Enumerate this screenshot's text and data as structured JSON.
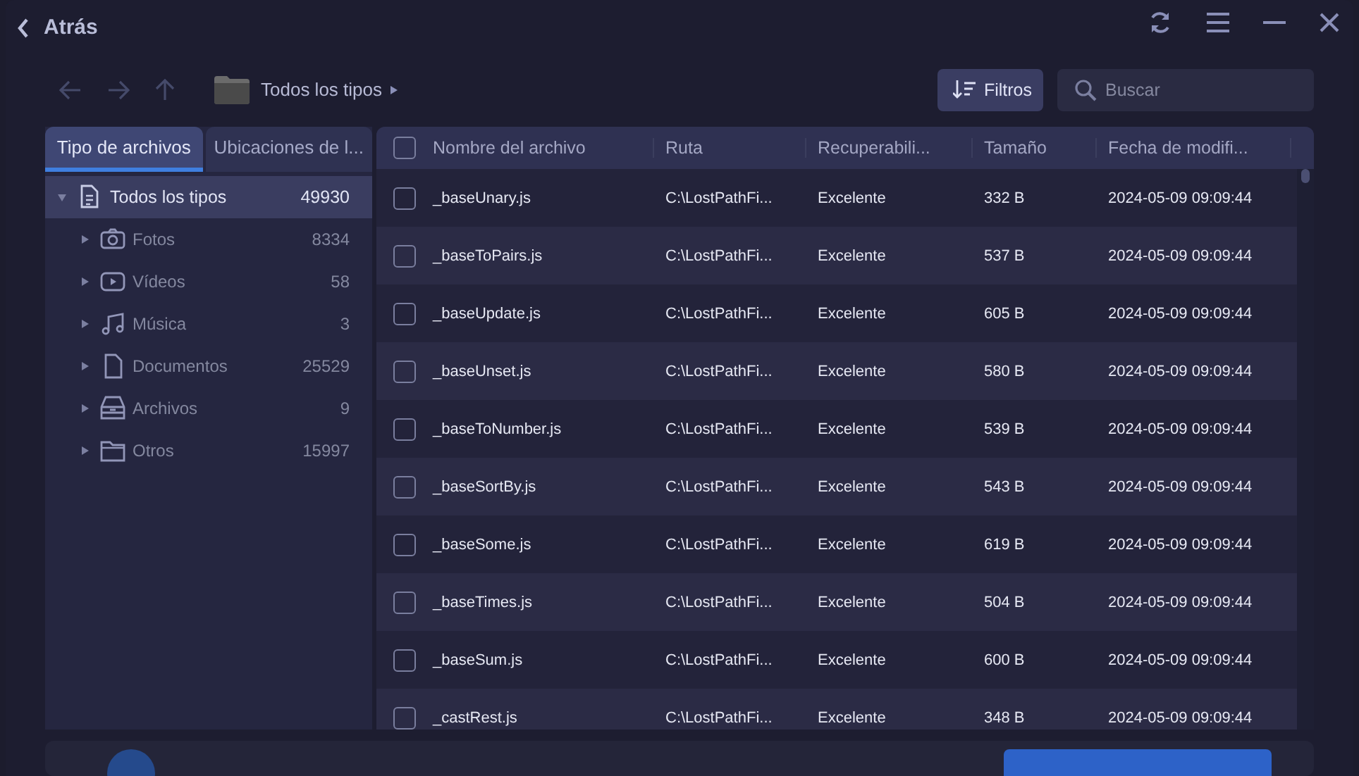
{
  "header": {
    "back_label": "Atrás"
  },
  "toolbar": {
    "breadcrumb": "Todos los tipos",
    "filter_label": "Filtros",
    "search": {
      "placeholder": "Buscar"
    }
  },
  "side_tabs": [
    {
      "label": "Tipo de archivos",
      "selected": true
    },
    {
      "label": "Ubicaciones de l...",
      "selected": false
    }
  ],
  "tree": [
    {
      "label": "Todos los tipos",
      "count": "49930",
      "kind": "document",
      "selected": true,
      "expanded": true,
      "children": [
        {
          "label": "Fotos",
          "count": "8334",
          "kind": "camera",
          "selected": false,
          "expanded": false
        },
        {
          "label": "Vídeos",
          "count": "58",
          "kind": "video",
          "selected": false,
          "expanded": false
        },
        {
          "label": "Música",
          "count": "3",
          "kind": "music",
          "selected": false,
          "expanded": false
        },
        {
          "label": "Documentos",
          "count": "25529",
          "kind": "file",
          "selected": false,
          "expanded": false
        },
        {
          "label": "Archivos",
          "count": "9",
          "kind": "archive",
          "selected": false,
          "expanded": false
        },
        {
          "label": "Otros",
          "count": "15997",
          "kind": "folder",
          "selected": false,
          "expanded": false
        }
      ]
    }
  ],
  "table": {
    "select_all_checked": false,
    "columns": [
      "Nombre del archivo",
      "Ruta",
      "Recuperabili...",
      "Tamaño",
      "Fecha de modifi..."
    ],
    "rows": [
      {
        "name": "_baseUnary.js",
        "path": "C:\\LostPathFi...",
        "recoverability": "Excelente",
        "size": "332 B",
        "modified": "2024-05-09 09:09:44",
        "checked": false
      },
      {
        "name": "_baseToPairs.js",
        "path": "C:\\LostPathFi...",
        "recoverability": "Excelente",
        "size": "537 B",
        "modified": "2024-05-09 09:09:44",
        "checked": false
      },
      {
        "name": "_baseUpdate.js",
        "path": "C:\\LostPathFi...",
        "recoverability": "Excelente",
        "size": "605 B",
        "modified": "2024-05-09 09:09:44",
        "checked": false
      },
      {
        "name": "_baseUnset.js",
        "path": "C:\\LostPathFi...",
        "recoverability": "Excelente",
        "size": "580 B",
        "modified": "2024-05-09 09:09:44",
        "checked": false
      },
      {
        "name": "_baseToNumber.js",
        "path": "C:\\LostPathFi...",
        "recoverability": "Excelente",
        "size": "539 B",
        "modified": "2024-05-09 09:09:44",
        "checked": false
      },
      {
        "name": "_baseSortBy.js",
        "path": "C:\\LostPathFi...",
        "recoverability": "Excelente",
        "size": "543 B",
        "modified": "2024-05-09 09:09:44",
        "checked": false
      },
      {
        "name": "_baseSome.js",
        "path": "C:\\LostPathFi...",
        "recoverability": "Excelente",
        "size": "619 B",
        "modified": "2024-05-09 09:09:44",
        "checked": false
      },
      {
        "name": "_baseTimes.js",
        "path": "C:\\LostPathFi...",
        "recoverability": "Excelente",
        "size": "504 B",
        "modified": "2024-05-09 09:09:44",
        "checked": false
      },
      {
        "name": "_baseSum.js",
        "path": "C:\\LostPathFi...",
        "recoverability": "Excelente",
        "size": "600 B",
        "modified": "2024-05-09 09:09:44",
        "checked": false
      },
      {
        "name": "_castRest.js",
        "path": "C:\\LostPathFi...",
        "recoverability": "Excelente",
        "size": "348 B",
        "modified": "2024-05-09 09:09:44",
        "checked": false
      }
    ]
  }
}
